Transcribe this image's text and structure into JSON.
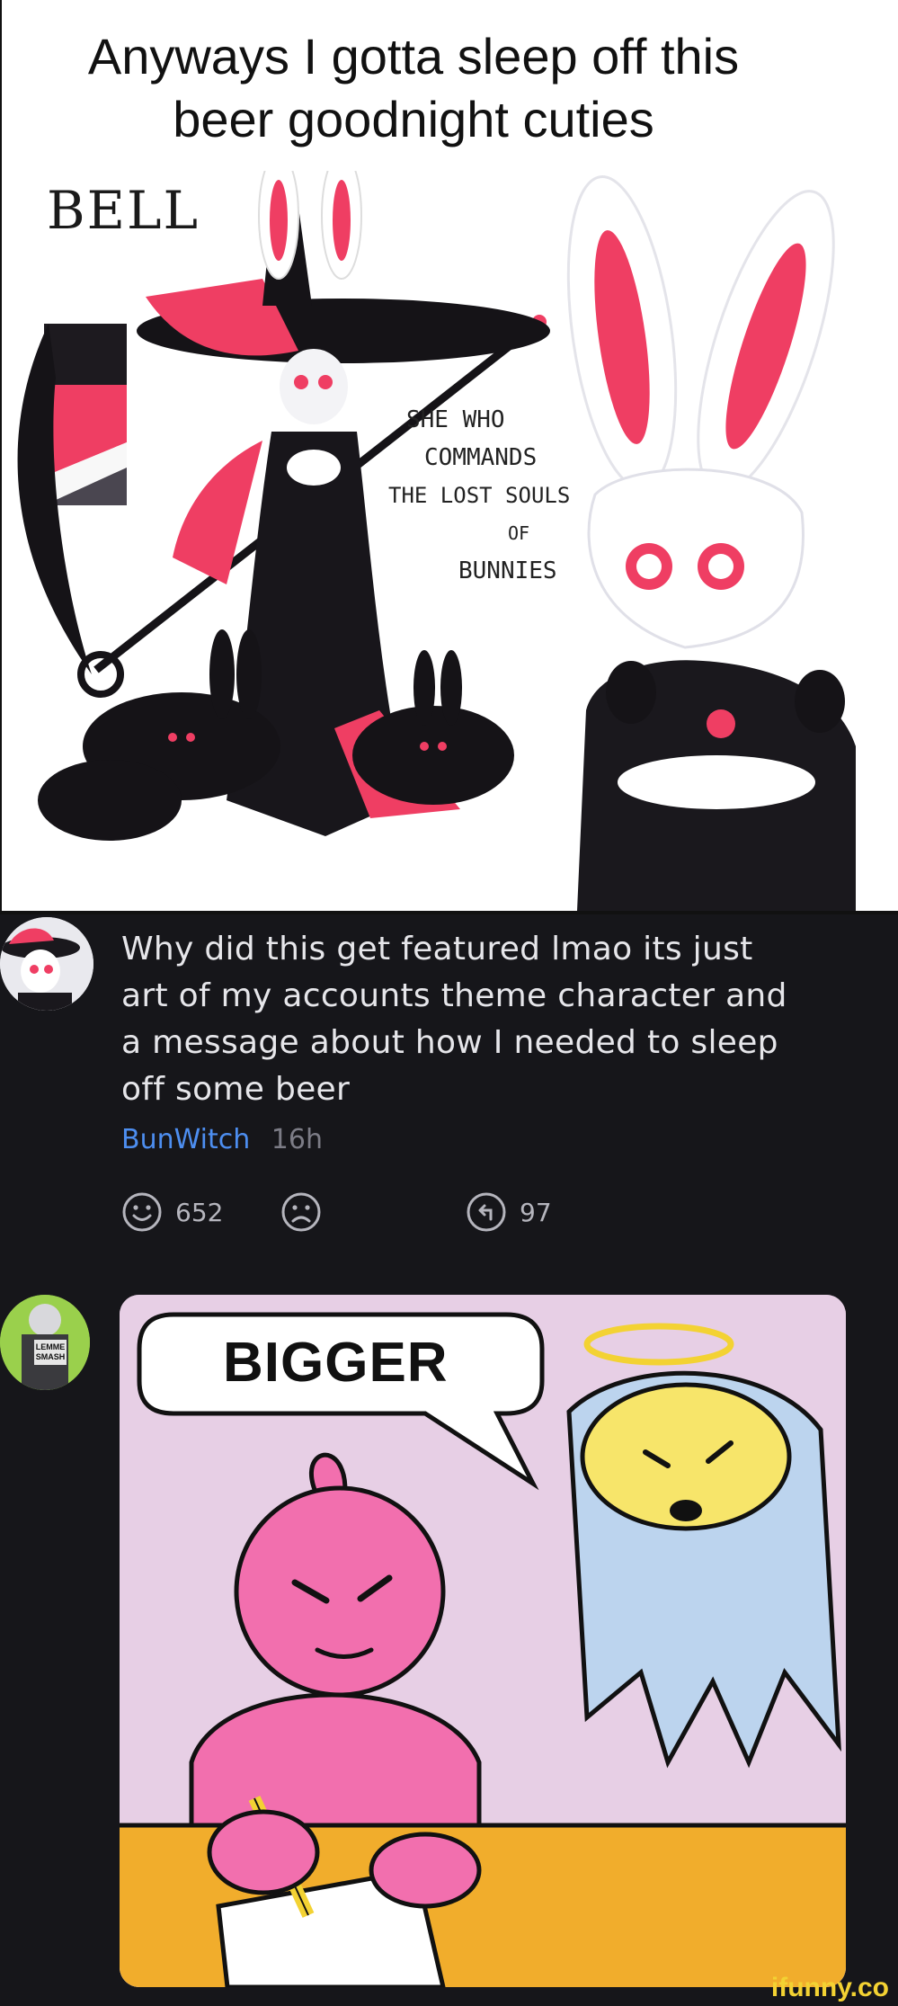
{
  "top_meme": {
    "caption_line1": "Anyways I gotta sleep off this",
    "caption_line2": "beer goodnight cuties",
    "art_title": "BELL",
    "art_tagline": [
      "SHE WHO",
      "COMMANDS",
      "THE LOST SOULS",
      "OF",
      "BUNNIES"
    ]
  },
  "comment": {
    "text_lines": [
      "Why did this get featured lmao its just",
      "art of my accounts theme character and",
      "a message about how I needed to sleep",
      "off some beer"
    ],
    "username": "BunWitch",
    "time": "16h",
    "smile_count": "652",
    "repost_count": "97",
    "icons": [
      "smile-icon",
      "frown-icon",
      "repost-icon"
    ]
  },
  "reply": {
    "avatar_text": "LEMME SMASH",
    "meme_bubble_text": "BIGGER"
  },
  "watermark": "ifunny.co",
  "colors": {
    "dark_bg": "#16161a",
    "username": "#4d8ef0",
    "accent_pink": "#ef3e63",
    "watermark": "#f3d233"
  }
}
